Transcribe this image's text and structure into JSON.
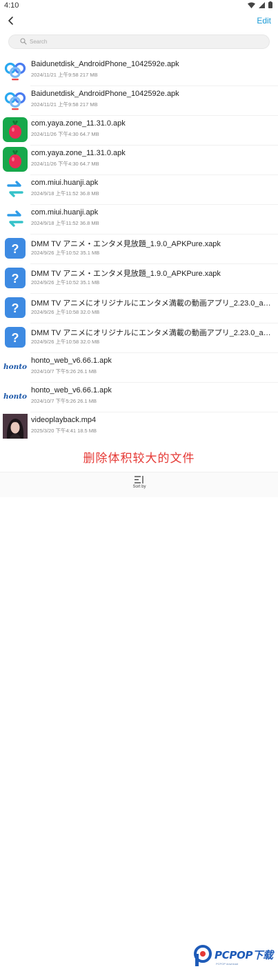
{
  "status": {
    "time": "4:10"
  },
  "header": {
    "edit_label": "Edit"
  },
  "search": {
    "placeholder": "Search"
  },
  "files": [
    {
      "name": "Baidunetdisk_AndroidPhone_1042592e.apk",
      "meta": "2024/11/21 上午9:58 217 MB",
      "icon": "baidu-netdisk-icon"
    },
    {
      "name": "Baidunetdisk_AndroidPhone_1042592e.apk",
      "meta": "2024/11/21 上午9:58 217 MB",
      "icon": "baidu-netdisk-icon"
    },
    {
      "name": "com.yaya.zone_11.31.0.apk",
      "meta": "2024/11/26 下午4:30 64.7 MB",
      "icon": "radish-icon"
    },
    {
      "name": "com.yaya.zone_11.31.0.apk",
      "meta": "2024/11/26 下午4:30 64.7 MB",
      "icon": "radish-icon"
    },
    {
      "name": "com.miui.huanji.apk",
      "meta": "2024/9/18 上午11:52 36.8 MB",
      "icon": "transfer-arrows-icon"
    },
    {
      "name": "com.miui.huanji.apk",
      "meta": "2024/9/18 上午11:52 36.8 MB",
      "icon": "transfer-arrows-icon"
    },
    {
      "name": "DMM TV アニメ・エンタメ見放題_1.9.0_APKPure.xapk",
      "meta": "2024/9/26 上午10:52 35.1 MB",
      "icon": "unknown-file-icon"
    },
    {
      "name": "DMM TV アニメ・エンタメ見放題_1.9.0_APKPure.xapk",
      "meta": "2024/9/26 上午10:52 35.1 MB",
      "icon": "unknown-file-icon"
    },
    {
      "name": "DMM TV アニメにオリジナルにエンタメ満載の動画アプリ_2.23.0_apkcombo.com.apk",
      "meta": "2024/9/26 上午10:58 32.0 MB",
      "icon": "unknown-file-icon"
    },
    {
      "name": "DMM TV アニメにオリジナルにエンタメ満載の動画アプリ_2.23.0_apkcombo.com.apk",
      "meta": "2024/9/26 上午10:58 32.0 MB",
      "icon": "unknown-file-icon"
    },
    {
      "name": "honto_web_v6.66.1.apk",
      "meta": "2024/10/7 下午5:26 26.1 MB",
      "icon": "honto-logo-icon"
    },
    {
      "name": "honto_web_v6.66.1.apk",
      "meta": "2024/10/7 下午5:26 26.1 MB",
      "icon": "honto-logo-icon"
    },
    {
      "name": "videoplayback.mp4",
      "meta": "2025/3/20 下午4:41 18.5 MB",
      "icon": "video-thumbnail-icon"
    }
  ],
  "caption": "删除体积较大的文件",
  "bottom": {
    "sort_label": "Sort by"
  },
  "watermark": {
    "brand": "PCPOP下载",
    "sub": "PCPOP download"
  },
  "colors": {
    "accent": "#1a9ad6",
    "caption": "#e53935",
    "brand": "#1e5bb8"
  },
  "honto_text": "honto"
}
